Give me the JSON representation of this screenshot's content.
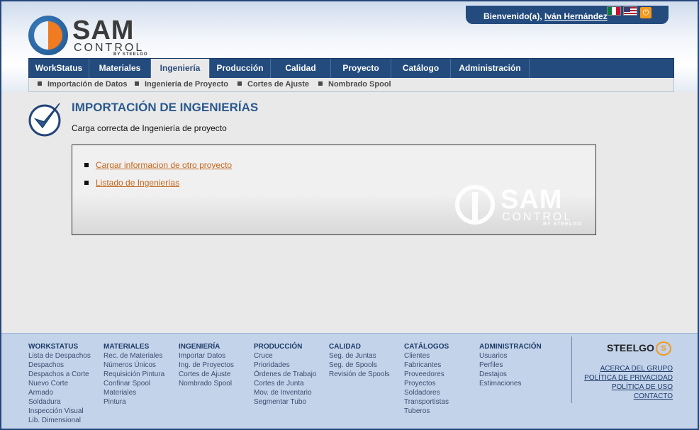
{
  "header": {
    "logo": {
      "sam": "SAM",
      "control": "CONTROL",
      "by": "BY STEELGO"
    },
    "welcome_prefix": "Bienvenido(a), ",
    "user_name": "Iván Hernández"
  },
  "nav": {
    "items": [
      "WorkStatus",
      "Materiales",
      "Ingeniería",
      "Producción",
      "Calidad",
      "Proyecto",
      "Catálogo",
      "Administración"
    ],
    "active": "Ingeniería"
  },
  "subnav": {
    "items": [
      "Importación de Datos",
      "Ingeniería de Proyecto",
      "Cortes de Ajuste",
      "Nombrado Spool"
    ]
  },
  "main": {
    "title": "IMPORTACIÓN DE INGENIERÍAS",
    "subtitle": "Carga correcta de Ingeniería de proyecto",
    "links": [
      "Cargar informacion de otro proyecto",
      "Listado de Ingenierías"
    ]
  },
  "footer": {
    "columns": [
      {
        "heading": "WORKSTATUS",
        "items": [
          "Lista de Despachos",
          "Despachos",
          "Despachos a Corte",
          "Nuevo Corte",
          "Armado",
          "Soldadura",
          "Inspección Visual",
          "Lib. Dimensional"
        ]
      },
      {
        "heading": "MATERIALES",
        "items": [
          "Rec. de Materiales",
          "Números Únicos",
          "Requisición Pintura",
          "Confinar Spool",
          "Materiales",
          "Pintura"
        ]
      },
      {
        "heading": "INGENIERÍA",
        "items": [
          "Importar Datos",
          "Ing. de Proyectos",
          "Cortes de Ajuste",
          "Nombrado Spool"
        ]
      },
      {
        "heading": "PRODUCCIÓN",
        "items": [
          "Cruce",
          "Prioridades",
          "Órdenes de Trabajo",
          "Cortes de Junta",
          "Mov. de Inventario",
          "Segmentar Tubo"
        ]
      },
      {
        "heading": "CALIDAD",
        "items": [
          "Seg. de Juntas",
          "Seg. de Spools",
          "Revisión de Spools"
        ]
      },
      {
        "heading": "CATÁLOGOS",
        "items": [
          "Clientes",
          "Fabricantes",
          "Proveedores",
          "Proyectos",
          "Soldadores",
          "Transportistas",
          "Tuberos"
        ]
      },
      {
        "heading": "ADMINISTRACIÓN",
        "items": [
          "Usuarios",
          "Perfiles",
          "Destajos",
          "Estimaciones"
        ]
      }
    ],
    "brand": "STEELGO",
    "links": [
      "ACERCA DEL GRUPO",
      "POLÍTICA DE PRIVACIDAD",
      "POLÍTICA DE USO",
      "CONTACTO"
    ]
  }
}
